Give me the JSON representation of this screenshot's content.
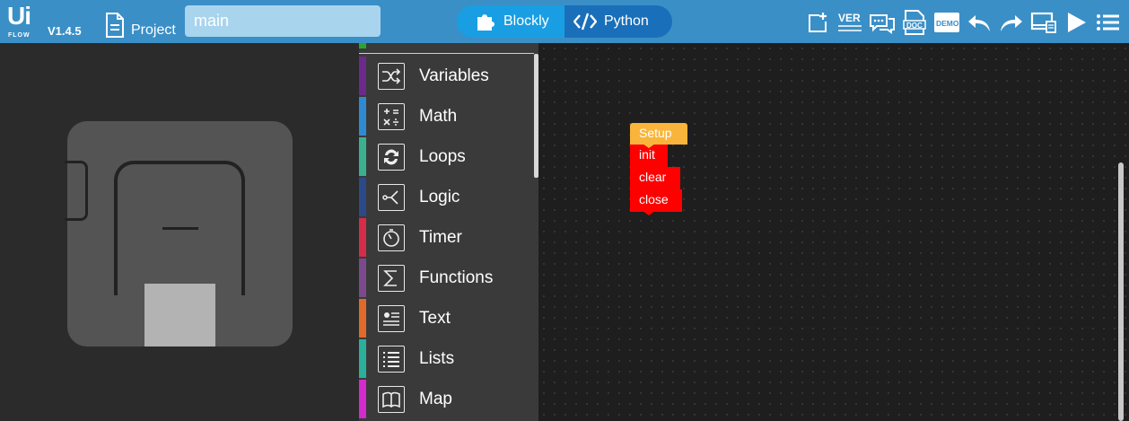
{
  "app": {
    "logo_main": "Ui",
    "logo_sub": "FLOW",
    "version": "V1.4.5"
  },
  "header": {
    "project_label": "Project",
    "file_name": "main",
    "mode_blockly": "Blockly",
    "mode_python": "Python",
    "tools": [
      {
        "name": "new-file-icon"
      },
      {
        "name": "version-icon"
      },
      {
        "name": "comment-icon"
      },
      {
        "name": "doc-icon"
      },
      {
        "name": "demo-icon"
      },
      {
        "name": "undo-icon"
      },
      {
        "name": "redo-icon"
      },
      {
        "name": "device-icon"
      },
      {
        "name": "run-icon"
      },
      {
        "name": "menu-icon"
      }
    ],
    "tool_labels": {
      "version": "VER",
      "doc": "DOC",
      "demo": "DEMO"
    }
  },
  "toolbox": {
    "categories": [
      {
        "label": "Variables",
        "color": "#6b2a8c",
        "icon": "shuffle-icon"
      },
      {
        "label": "Math",
        "color": "#2f8bd1",
        "icon": "math-icon"
      },
      {
        "label": "Loops",
        "color": "#3bb08f",
        "icon": "loop-icon"
      },
      {
        "label": "Logic",
        "color": "#2a4a8a",
        "icon": "logic-icon"
      },
      {
        "label": "Timer",
        "color": "#d62c4a",
        "icon": "timer-icon"
      },
      {
        "label": "Functions",
        "color": "#7a4a8c",
        "icon": "sigma-icon"
      },
      {
        "label": "Text",
        "color": "#e06a2a",
        "icon": "text-icon"
      },
      {
        "label": "Lists",
        "color": "#2ab09a",
        "icon": "list-icon"
      },
      {
        "label": "Map",
        "color": "#d42ad0",
        "icon": "map-icon"
      }
    ]
  },
  "workspace": {
    "blocks": {
      "setup": "Setup",
      "init": "init",
      "clear": "clear",
      "close": "close"
    }
  },
  "colors": {
    "topbar": "#3a8fc7",
    "setup_block": "#f9b53b",
    "action_block": "#ff0000"
  }
}
